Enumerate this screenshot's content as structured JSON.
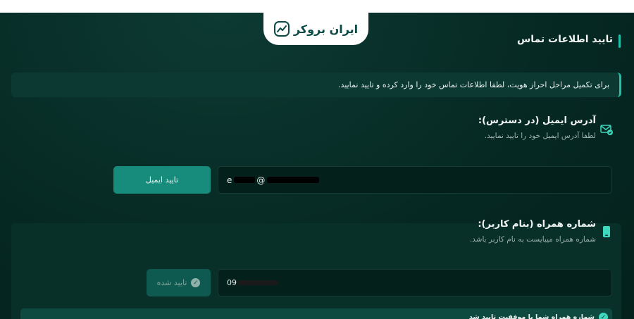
{
  "brand": {
    "logo_text": "ایران بروکر",
    "accent": "#20c1a9"
  },
  "page": {
    "title": "تایید اطلاعات تماس"
  },
  "notice": {
    "text": "برای تکمیل مراحل احراز هویت، لطفا اطلاعات تماس خود را وارد کرده و تایید نمایید."
  },
  "email": {
    "title": "آدرس ایمیل (در دسترس):",
    "subtitle": "لطفا آدرس ایمیل خود را تایید نمایید.",
    "value_start": "e",
    "value_mid": "@",
    "button_label": "تایید ایمیل",
    "icon": "mail-check-icon"
  },
  "phone": {
    "title": "شماره همراه (بنام کاربر):",
    "subtitle": "شماره همراه میبایست به نام کاربر باشد.",
    "value": "09",
    "button_label": "تایید شده",
    "icon": "mobile-phone-icon"
  },
  "success": {
    "text": "شماره همراه شما با موفقیت تایید شد",
    "color": "#3ed8bc"
  }
}
